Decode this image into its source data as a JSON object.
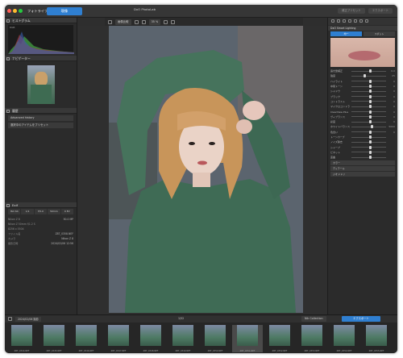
{
  "titlebar": {
    "tab_library": "フォトライブラリ",
    "tab_develop": "現像",
    "center_title": "DxO PhotoLab",
    "right_pill_1": "補正プリセット",
    "right_pill_2": "エクスポート"
  },
  "toolbar": {
    "btn_compare": "画像比較",
    "zoom": "35 %"
  },
  "left": {
    "histogram_title": "ヒストグラム",
    "histogram_tab": "RGB",
    "navigator_title": "ナビゲーター",
    "history_title": "履歴",
    "history_item": "Advanced history",
    "history_btn": "選択中のアイテムをプリセット",
    "exif_title": "Exif",
    "exif_values": [
      "ISO 64",
      "1/1",
      "f/5.0",
      "50mm",
      "0 EV"
    ],
    "meta": [
      {
        "k": "Nikon Z 8",
        "v": "50.0 MP"
      },
      {
        "k": "Nikon Z 50mm f/1.2 S",
        "v": ""
      },
      {
        "k": "8256 x 5504",
        "v": ""
      },
      {
        "k": "ファイル名",
        "v": "Z8T_0358.NEF"
      },
      {
        "k": "カメラ",
        "v": "Nikon Z 8"
      },
      {
        "k": "撮影日時",
        "v": "2024/02/06 12:56"
      }
    ]
  },
  "right": {
    "header": "DxO Smart Lighting",
    "mode_a": "均一",
    "mode_b": "スポット",
    "rows": [
      {
        "label": "露光量補正",
        "value": "0.0",
        "pos": 0.5
      },
      {
        "label": "強度",
        "value": "25",
        "pos": 0.35
      },
      {
        "label": "ハイライト",
        "value": "0",
        "pos": 0.5
      },
      {
        "label": "中間トーン",
        "value": "0",
        "pos": 0.5
      },
      {
        "label": "シャドウ",
        "value": "0",
        "pos": 0.5
      },
      {
        "label": "ブラック",
        "value": "0",
        "pos": 0.5
      },
      {
        "label": "コントラスト",
        "value": "0",
        "pos": 0.5
      },
      {
        "label": "マイクロコントラスト",
        "value": "0",
        "pos": 0.5
      },
      {
        "label": "ClearView Plus",
        "value": "0",
        "pos": 0.5
      },
      {
        "label": "ヴィブランス",
        "value": "0",
        "pos": 0.5
      },
      {
        "label": "彩度",
        "value": "0",
        "pos": 0.5
      },
      {
        "label": "ホワイトバランス",
        "value": "5000",
        "pos": 0.55
      },
      {
        "label": "色合い",
        "value": "0",
        "pos": 0.5
      },
      {
        "label": "トーンカーブ",
        "value": "",
        "pos": 0.5
      },
      {
        "label": "ノイズ除去",
        "value": "",
        "pos": 0.5
      },
      {
        "label": "シャープ",
        "value": "",
        "pos": 0.5
      },
      {
        "label": "ビネット",
        "value": "",
        "pos": 0.5
      },
      {
        "label": "歪曲",
        "value": "",
        "pos": 0.5
      }
    ],
    "section_color": "カラー",
    "section_detail": "ディテール",
    "section_geometry": "ジオメトリ"
  },
  "bottom": {
    "path": "2024/02/06 撮影",
    "count": "1/52",
    "tab_nik": "Nik Collection",
    "tab_export": "エクスポート",
    "thumbs": [
      "Z8T_0344.NEF",
      "Z8T_0345.NEF",
      "Z8T_0346.NEF",
      "Z8T_0347.NEF",
      "Z8T_0348.NEF",
      "Z8T_0349.NEF",
      "Z8T_0350.NEF",
      "Z8T_0351.NEF",
      "Z8T_0352.NEF",
      "Z8T_0353.NEF",
      "Z8T_0354.NEF",
      "Z8T_0355.NEF"
    ]
  },
  "colors": {
    "accent": "#2f7fd1",
    "export": "#2f7fd1"
  }
}
